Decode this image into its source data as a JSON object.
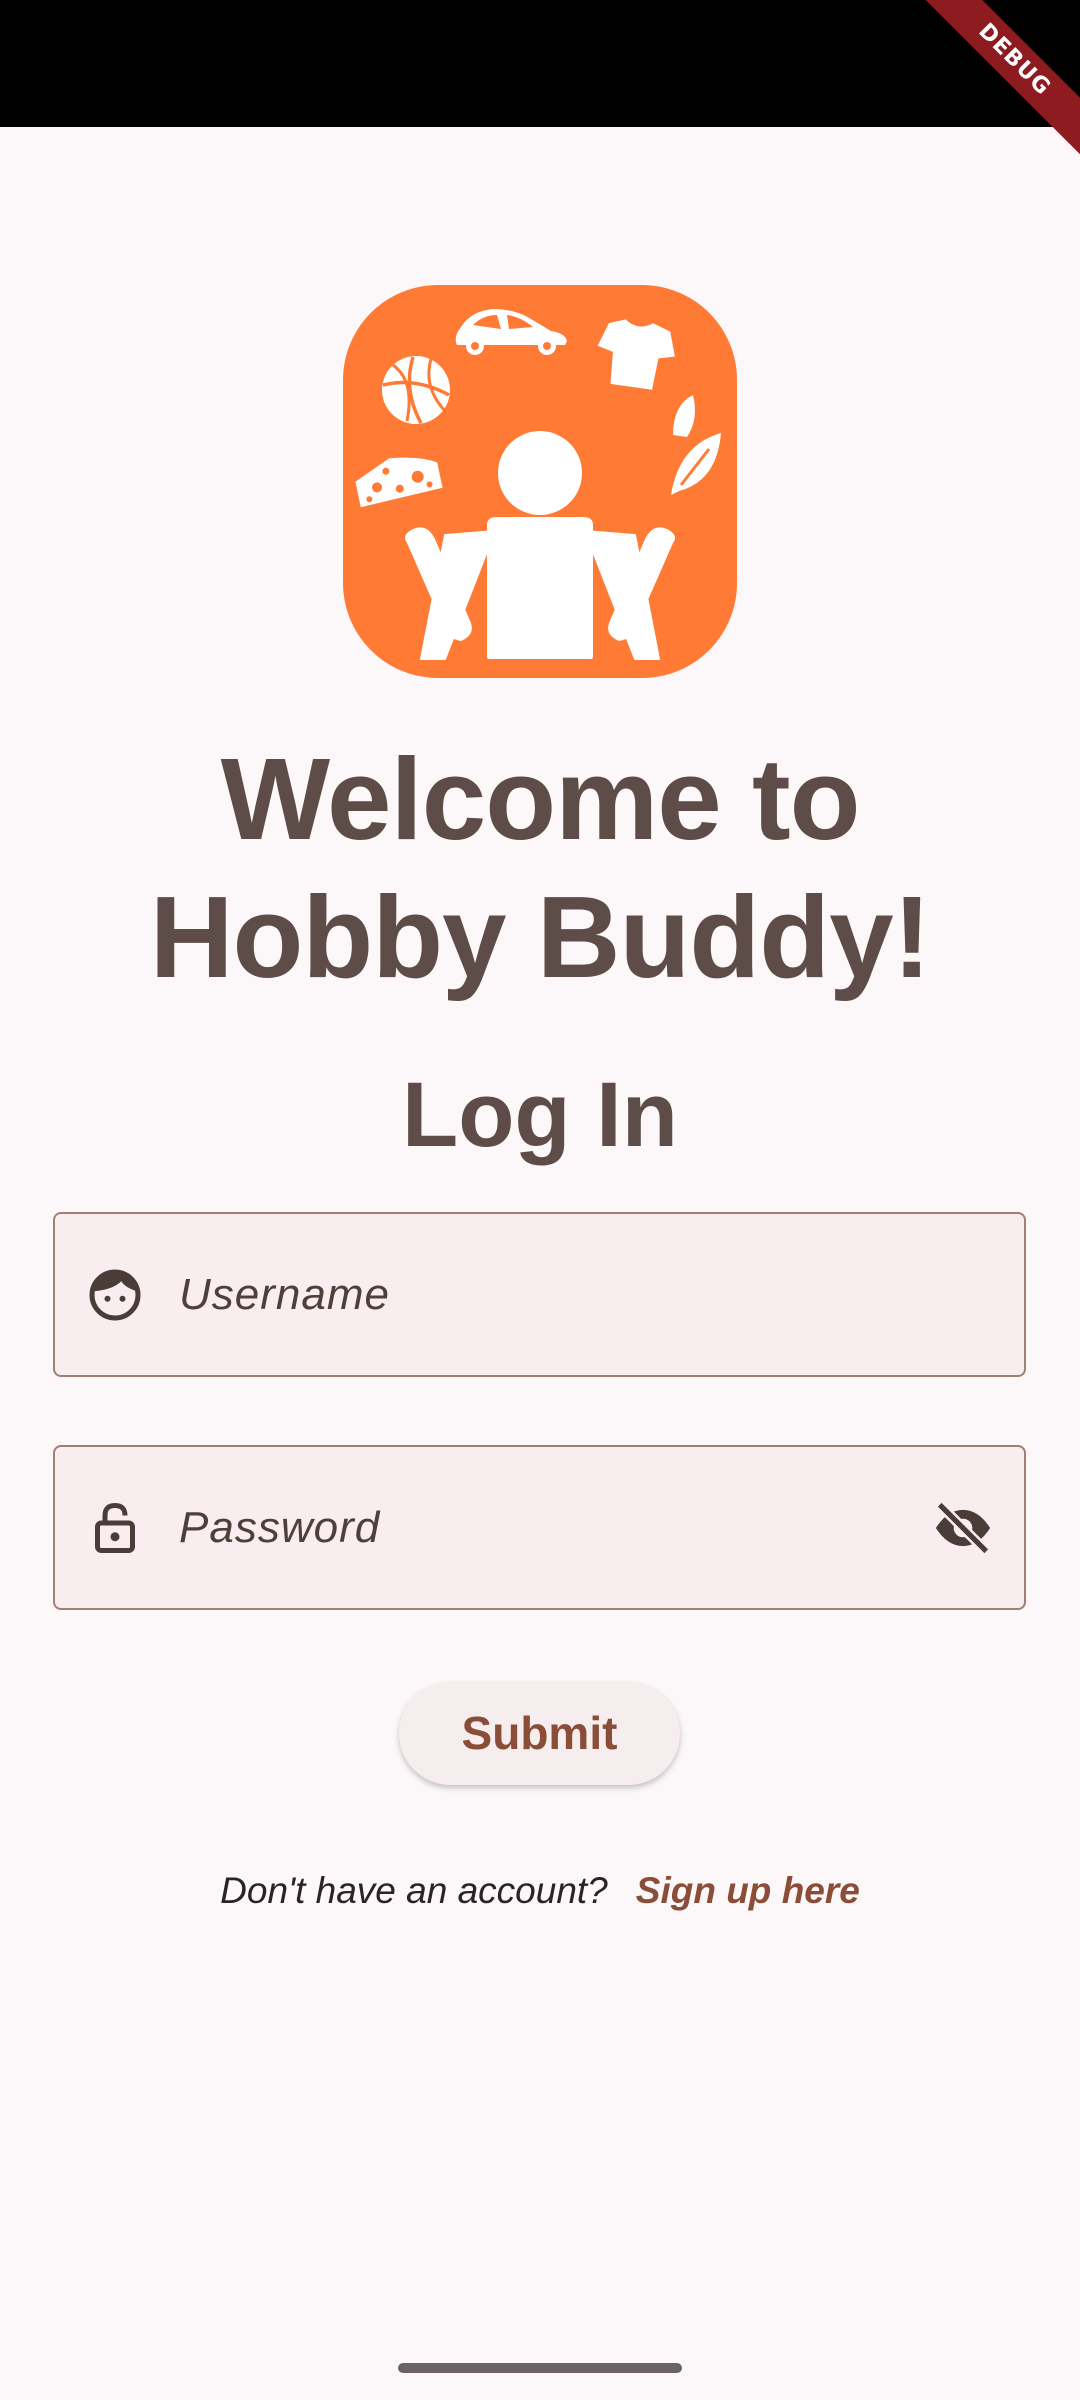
{
  "app": {
    "debug_banner": "DEBUG"
  },
  "header": {
    "welcome_line_1": "Welcome to",
    "welcome_line_2": "Hobby Buddy!",
    "login_heading": "Log In"
  },
  "form": {
    "username": {
      "value": "",
      "placeholder": "Username",
      "icon": "face-icon"
    },
    "password": {
      "value": "",
      "placeholder": "Password",
      "icon": "lock-open-icon",
      "toggle_icon": "visibility-off-icon"
    },
    "submit_label": "Submit"
  },
  "signup": {
    "prompt": "Don't have an account?",
    "link_label": "Sign up here"
  },
  "colors": {
    "background": "#FCF7F8",
    "logo_orange": "#FF7A35",
    "title_text": "#5E4C48",
    "accent_brown": "#8A4E38",
    "field_fill": "#F8EEEF",
    "field_border": "#A07F75"
  }
}
